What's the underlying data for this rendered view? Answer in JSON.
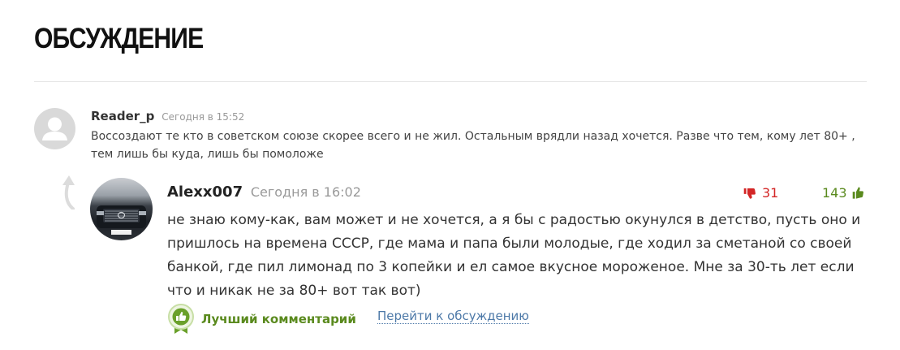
{
  "section": {
    "title": "ОБСУЖДЕНИЕ"
  },
  "comment1": {
    "author": "Reader_p",
    "time": "Сегодня в 15:52",
    "text": "Воссоздают те кто в советском союзе скорее всего и не жил. Остальным врядли назад хочется. Разве что тем, кому лет 80+ , тем лишь бы куда, лишь бы помоложе",
    "avatar_icon": "default-user-avatar"
  },
  "reply": {
    "author": "Alexx007",
    "time": "Сегодня в 16:02",
    "text": "не знаю кому-как, вам может и не хочется, а я бы с радостью окунулся в детство, пусть оно и пришлось на времена СССР, где мама и папа были молодые, где ходил за сметаной со своей банкой, где пил лимонад по 3 копейки и ел самое вкусное мороженое. Мне за 30-ть лет если что и никак не за 80+ вот так вот)",
    "dislikes": "31",
    "likes": "143",
    "best_label": "Лучший комментарий",
    "goto_label": "Перейти к обсуждению",
    "colors": {
      "down": "#d32626",
      "up": "#5a8a1e",
      "link": "#4d79a8"
    }
  }
}
